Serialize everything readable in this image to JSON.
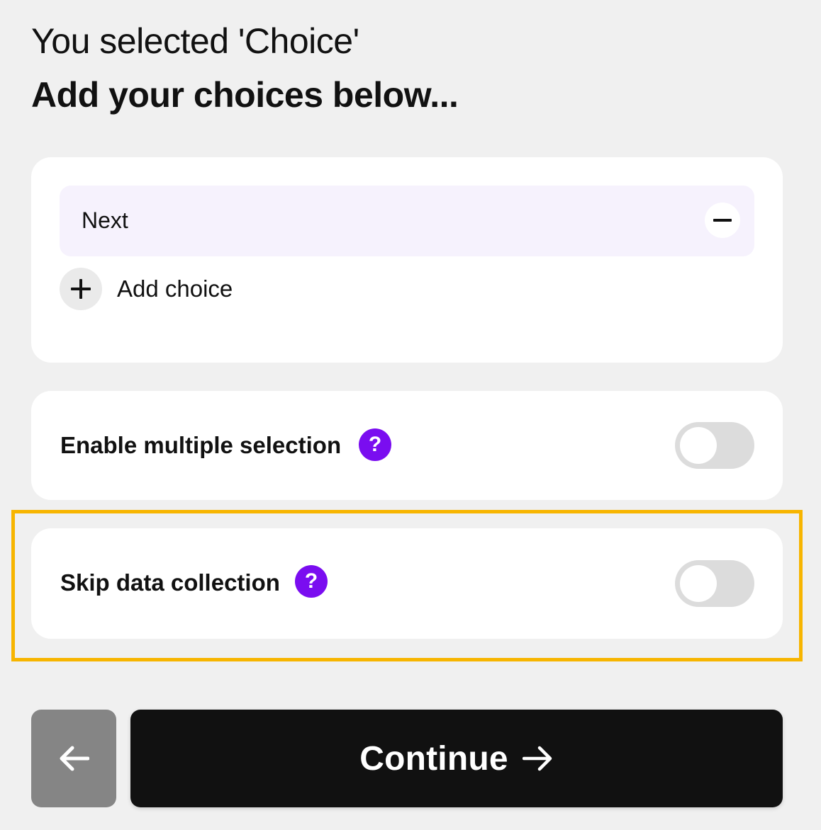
{
  "header": {
    "subtitle": "You selected 'Choice'",
    "title": "Add your choices below..."
  },
  "choices": {
    "items": [
      {
        "label": "Next"
      }
    ],
    "add_label": "Add choice"
  },
  "options": [
    {
      "label": "Enable multiple selection",
      "help_glyph": "?",
      "enabled": false
    },
    {
      "label": "Skip data collection",
      "help_glyph": "?",
      "enabled": false
    }
  ],
  "footer": {
    "continue_label": "Continue"
  },
  "colors": {
    "accent": "#7a0df0",
    "highlight": "#f7b500",
    "choice_bg": "#f6f2fd",
    "primary_button": "#111111",
    "back_button": "#858585"
  }
}
